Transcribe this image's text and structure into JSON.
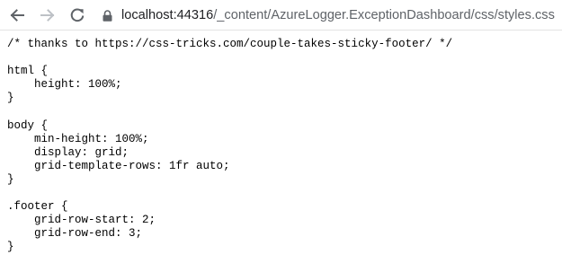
{
  "browser": {
    "host": "localhost:44316",
    "path": "/_content/AzureLogger.ExceptionDashboard/css/styles.css",
    "icons": {
      "back": "arrow-left-icon",
      "forward": "arrow-right-icon",
      "reload": "reload-icon",
      "lock": "lock-icon"
    }
  },
  "file": {
    "lines": [
      "/* thanks to https://css-tricks.com/couple-takes-sticky-footer/ */",
      "",
      "html {",
      "    height: 100%;",
      "}",
      "",
      "body {",
      "    min-height: 100%;",
      "    display: grid;",
      "    grid-template-rows: 1fr auto;",
      "}",
      "",
      ".footer {",
      "    grid-row-start: 2;",
      "    grid-row-end: 3;",
      "}"
    ]
  },
  "colors": {
    "icon_active": "#5f6368",
    "icon_disabled": "#bdc1c6",
    "url_host": "#202124",
    "url_path": "#5f6368",
    "text": "#000000"
  }
}
